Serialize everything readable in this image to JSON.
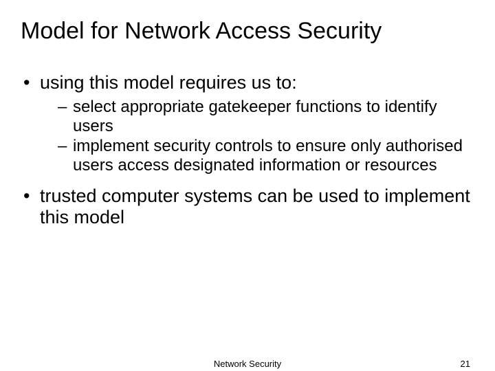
{
  "title": "Model for Network Access Security",
  "bullets": {
    "b1": "using this model requires us to:",
    "b1_sub1": "select appropriate gatekeeper functions to identify users",
    "b1_sub2": "implement security controls to ensure only authorised users access designated information or resources",
    "b2": "trusted computer systems can be used to implement this model"
  },
  "footer": {
    "label": "Network Security",
    "page": "21"
  }
}
